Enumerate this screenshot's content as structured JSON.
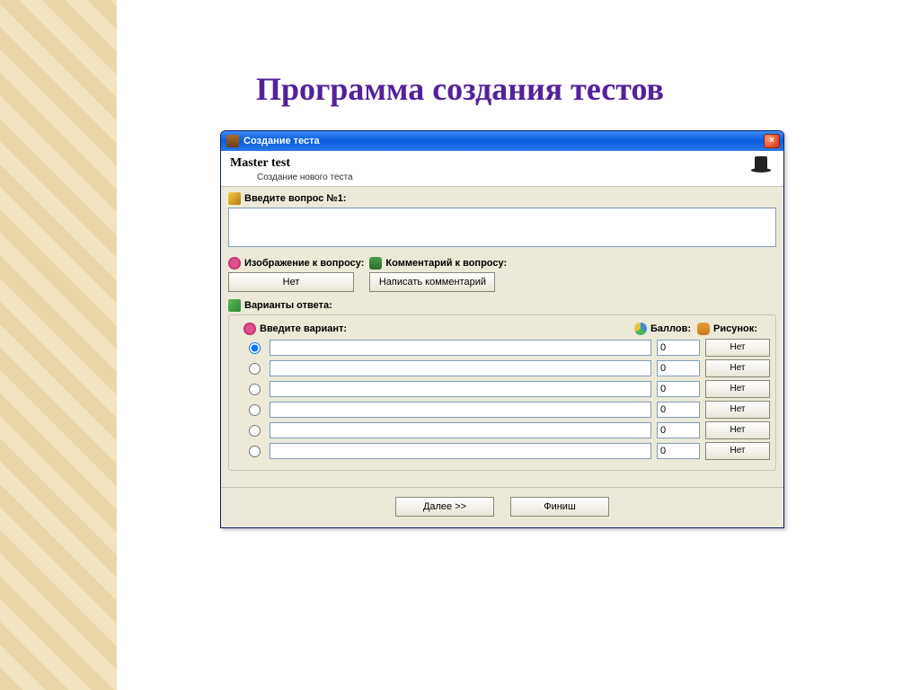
{
  "slide": {
    "title": "Программа создания тестов"
  },
  "window": {
    "title": "Создание теста",
    "close_label": "×"
  },
  "header": {
    "master": "Master test",
    "subtitle": "Создание нового теста"
  },
  "question": {
    "label": "Введите вопрос №1:",
    "value": ""
  },
  "image_sec": {
    "label": "Изображение к вопросу:",
    "button": "Нет"
  },
  "comment_sec": {
    "label": "Комментарий к вопросу:",
    "button": "Написать комментарий"
  },
  "answers": {
    "section_label": "Варианты ответа:",
    "col_variant": "Введите вариант:",
    "col_score": "Баллов:",
    "col_pic": "Рисунок:",
    "rows": [
      {
        "selected": true,
        "variant": "",
        "score": "0",
        "pic": "Нет"
      },
      {
        "selected": false,
        "variant": "",
        "score": "0",
        "pic": "Нет"
      },
      {
        "selected": false,
        "variant": "",
        "score": "0",
        "pic": "Нет"
      },
      {
        "selected": false,
        "variant": "",
        "score": "0",
        "pic": "Нет"
      },
      {
        "selected": false,
        "variant": "",
        "score": "0",
        "pic": "Нет"
      },
      {
        "selected": false,
        "variant": "",
        "score": "0",
        "pic": "Нет"
      }
    ]
  },
  "footer": {
    "next": "Далее >>",
    "finish": "Финиш"
  }
}
